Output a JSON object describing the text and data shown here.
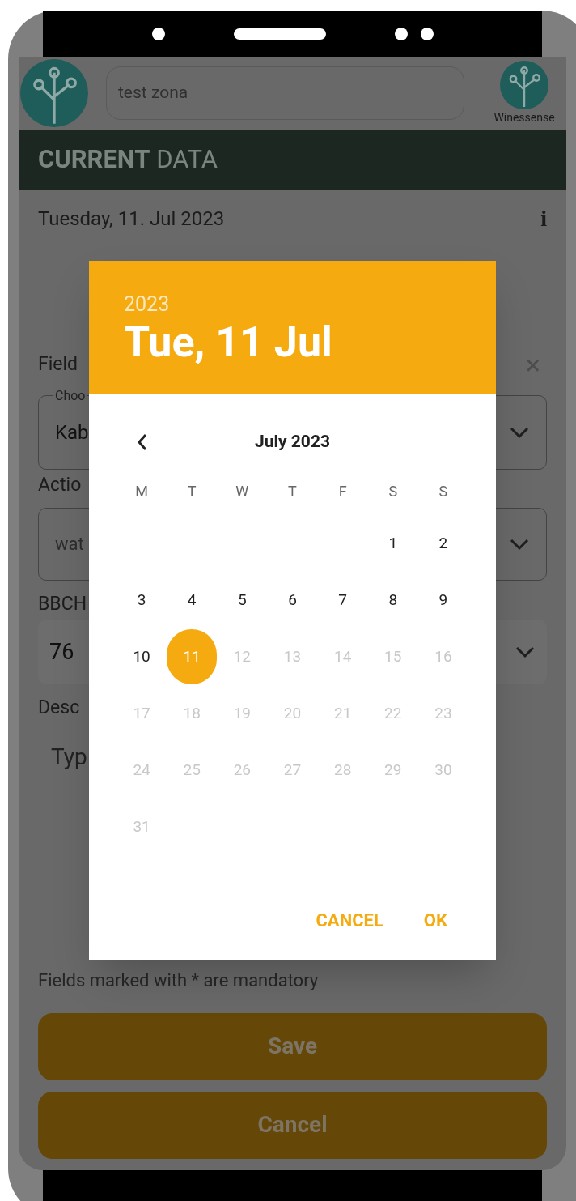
{
  "top_bar": {
    "search_value": "test zona",
    "brand": "Winessense"
  },
  "header": {
    "bold": "CURRENT",
    "rest": "DATA"
  },
  "date_row": {
    "text": "Tuesday, 11. Jul 2023",
    "info": "i"
  },
  "form": {
    "field_label": "Field",
    "field_legend": "Choo",
    "field_value": "Kab",
    "action_label": "Actio",
    "action_value": "wat",
    "bbch_label": "BBCH",
    "bbch_value": "76",
    "description_label": "Desc",
    "description_placeholder": "Typ",
    "close": "×"
  },
  "note": "Fields marked with * are mandatory",
  "buttons": [
    {
      "label": "Save"
    },
    {
      "label": "Cancel"
    }
  ],
  "date_picker": {
    "year": "2023",
    "date": "Tue, 11 Jul",
    "month": "July 2023",
    "weekdays": [
      "M",
      "T",
      "W",
      "T",
      "F",
      "S",
      "S"
    ],
    "weeks": [
      {
        "days": [
          {
            "label": "1",
            "selected": false,
            "disabled": false
          },
          {
            "label": "2",
            "selected": false,
            "disabled": false
          }
        ]
      },
      {
        "days": [
          {
            "label": "3",
            "selected": false,
            "disabled": false
          },
          {
            "label": "4",
            "selected": false,
            "disabled": false
          },
          {
            "label": "5",
            "selected": false,
            "disabled": false
          },
          {
            "label": "6",
            "selected": false,
            "disabled": false
          },
          {
            "label": "7",
            "selected": false,
            "disabled": false
          },
          {
            "label": "8",
            "selected": false,
            "disabled": false
          },
          {
            "label": "9",
            "selected": false,
            "disabled": false
          }
        ]
      },
      {
        "days": [
          {
            "label": "10",
            "selected": false,
            "disabled": false
          },
          {
            "label": "11",
            "selected": true,
            "disabled": false
          },
          {
            "label": "12",
            "selected": false,
            "disabled": true
          },
          {
            "label": "13",
            "selected": false,
            "disabled": true
          },
          {
            "label": "14",
            "selected": false,
            "disabled": true
          },
          {
            "label": "15",
            "selected": false,
            "disabled": true
          },
          {
            "label": "16",
            "selected": false,
            "disabled": true
          }
        ]
      },
      {
        "days": [
          {
            "label": "17",
            "selected": false,
            "disabled": true
          },
          {
            "label": "18",
            "selected": false,
            "disabled": true
          },
          {
            "label": "19",
            "selected": false,
            "disabled": true
          },
          {
            "label": "20",
            "selected": false,
            "disabled": true
          },
          {
            "label": "21",
            "selected": false,
            "disabled": true
          },
          {
            "label": "22",
            "selected": false,
            "disabled": true
          },
          {
            "label": "23",
            "selected": false,
            "disabled": true
          }
        ]
      },
      {
        "days": [
          {
            "label": "24",
            "selected": false,
            "disabled": true
          },
          {
            "label": "25",
            "selected": false,
            "disabled": true
          },
          {
            "label": "26",
            "selected": false,
            "disabled": true
          },
          {
            "label": "27",
            "selected": false,
            "disabled": true
          },
          {
            "label": "28",
            "selected": false,
            "disabled": true
          },
          {
            "label": "29",
            "selected": false,
            "disabled": true
          },
          {
            "label": "30",
            "selected": false,
            "disabled": true
          }
        ]
      },
      {
        "days": [
          {
            "label": "31",
            "selected": false,
            "disabled": true
          }
        ]
      }
    ],
    "actions": [
      {
        "label": "CANCEL"
      },
      {
        "label": "OK"
      }
    ]
  }
}
